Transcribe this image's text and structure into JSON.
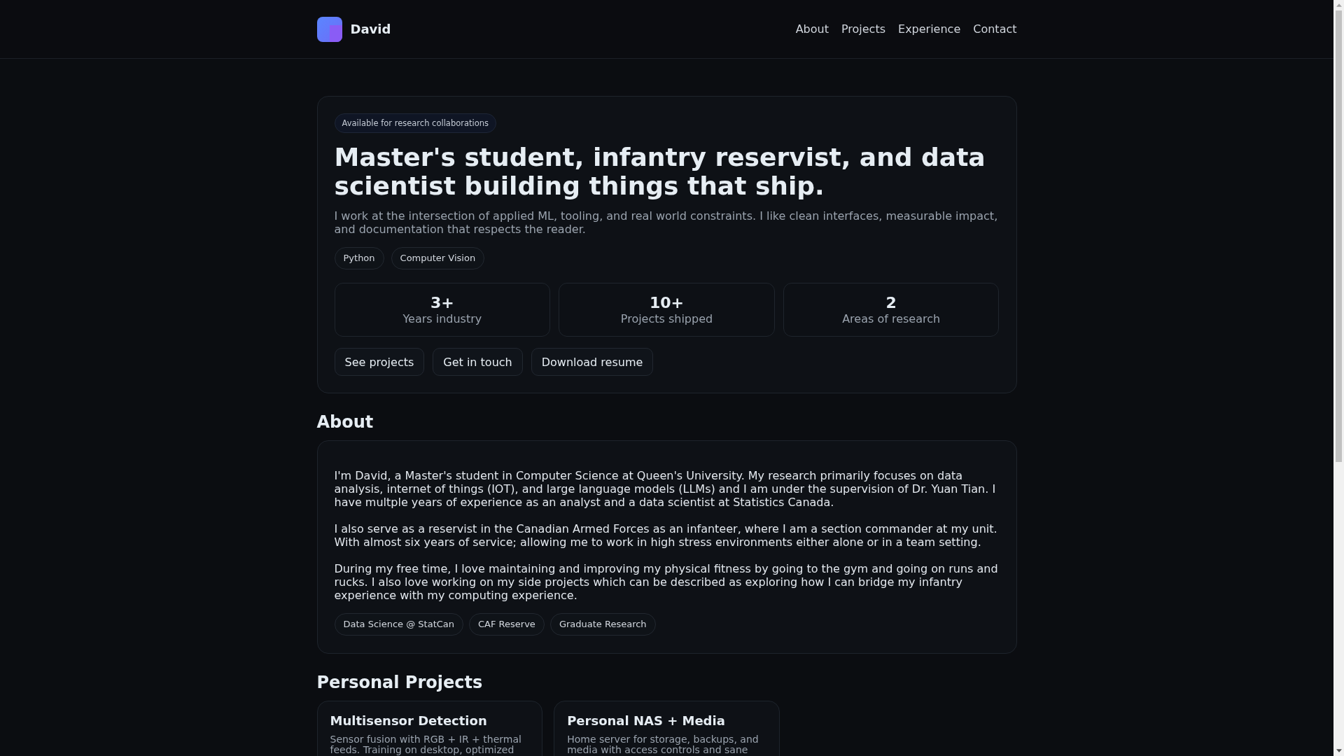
{
  "header": {
    "brand": "David",
    "nav": [
      "About",
      "Projects",
      "Experience",
      "Contact"
    ]
  },
  "hero": {
    "badge": "Available for research collaborations",
    "title": "Master's student, infantry reservist, and data scientist building things that ship.",
    "intro": "I work at the intersection of applied ML, tooling, and real world constraints. I like clean interfaces, measurable impact, and documentation that respects the reader.",
    "tags": [
      "Python",
      "Computer Vision"
    ],
    "stats": [
      {
        "value": "3+",
        "label": "Years industry"
      },
      {
        "value": "10+",
        "label": "Projects shipped"
      },
      {
        "value": "2",
        "label": "Areas of research"
      }
    ],
    "buttons": [
      "See projects",
      "Get in touch",
      "Download resume"
    ]
  },
  "about": {
    "heading": "About",
    "paragraphs": [
      "I'm David, a Master's student in Computer Science at Queen's University. My research primarily focuses on data analysis, internet of things (IOT), and large language models (LLMs) and I am under the supervision of Dr. Yuan Tian. I have multple years of experience as an analyst and a data scientist at Statistics Canada.",
      "I also serve as a reservist in the Canadian Armed Forces as an infanteer, where I am a section commander at my unit. With almost six years of service; allowing me to work in high stress environments either alone or in a team setting.",
      "During my free time, I love maintaining and improving my physical fitness by going to the gym and going on runs and rucks. I also love working on my side projects which can be described as exploring how I can bridge my infantry experience with my computing experience."
    ],
    "tags": [
      "Data Science @ StatCan",
      "CAF Reserve",
      "Graduate Research"
    ]
  },
  "projects": {
    "heading": "Personal Projects",
    "cards": [
      {
        "title": "Multisensor Detection",
        "description": "Sensor fusion with RGB + IR + thermal feeds. Training on desktop, optimized"
      },
      {
        "title": "Personal NAS + Media",
        "description": "Home server for storage, backups, and media with access controls and sane"
      }
    ]
  }
}
